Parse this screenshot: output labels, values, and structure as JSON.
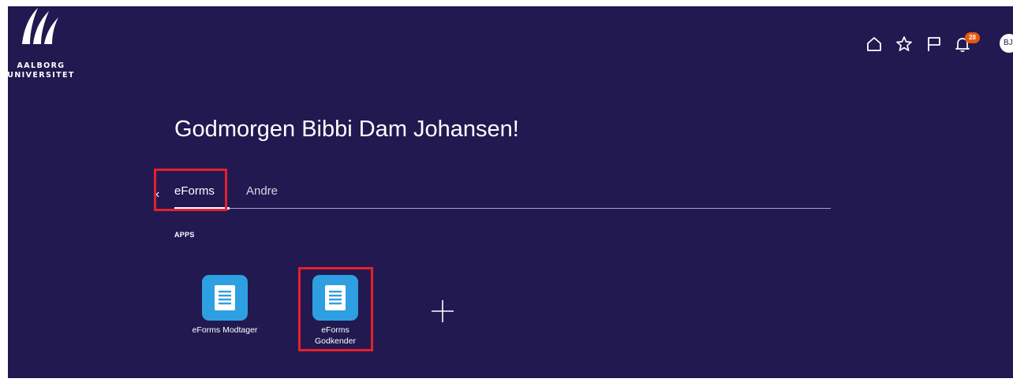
{
  "brand": {
    "logo_line1": "AALBORG",
    "logo_line2": "UNIVERSITET"
  },
  "header": {
    "icons": [
      "home-icon",
      "star-icon",
      "flag-icon",
      "bell-icon"
    ],
    "notification_count": "28",
    "avatar_initials": "BJ"
  },
  "greeting": "Godmorgen Bibbi Dam Johansen!",
  "tabs": [
    {
      "label": "eForms",
      "selected": true
    },
    {
      "label": "Andre",
      "selected": false
    }
  ],
  "section": {
    "label": "APPS"
  },
  "apps": [
    {
      "label": "eForms Modtager",
      "icon": "document-icon"
    },
    {
      "label": "eForms Godkender",
      "icon": "document-icon"
    }
  ],
  "colors": {
    "background": "#221951",
    "tile": "#2e9fe0",
    "highlight": "#e4212b",
    "badge": "#e8570f"
  }
}
